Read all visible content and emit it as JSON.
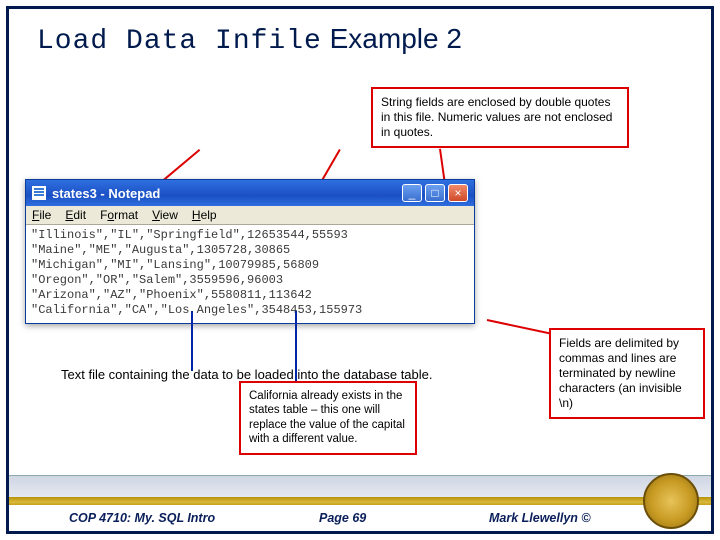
{
  "title_mono": "Load Data Infile",
  "title_rest": "Example 2",
  "callouts": {
    "top": "String fields are enclosed by double quotes in this file.  Numeric values are not enclosed in quotes.",
    "right": "Fields are delimited by commas and lines are terminated by newline characters (an invisible \\n)",
    "mid": "California already exists in the states table – this one will replace the value of the capital with a different value."
  },
  "plain_note": "Text file containing the data to be loaded into the database table.",
  "notepad": {
    "title": "states3 - Notepad",
    "menu": [
      "File",
      "Edit",
      "Format",
      "View",
      "Help"
    ],
    "lines": [
      "\"Illinois\",\"IL\",\"Springfield\",12653544,55593",
      "\"Maine\",\"ME\",\"Augusta\",1305728,30865",
      "\"Michigan\",\"MI\",\"Lansing\",10079985,56809",
      "\"Oregon\",\"OR\",\"Salem\",3559596,96003",
      "\"Arizona\",\"AZ\",\"Phoenix\",5580811,113642",
      "\"California\",\"CA\",\"Los Angeles\",3548453,155973"
    ]
  },
  "footer": {
    "left": "COP 4710: My. SQL Intro",
    "mid": "Page 69",
    "right": "Mark Llewellyn ©"
  }
}
